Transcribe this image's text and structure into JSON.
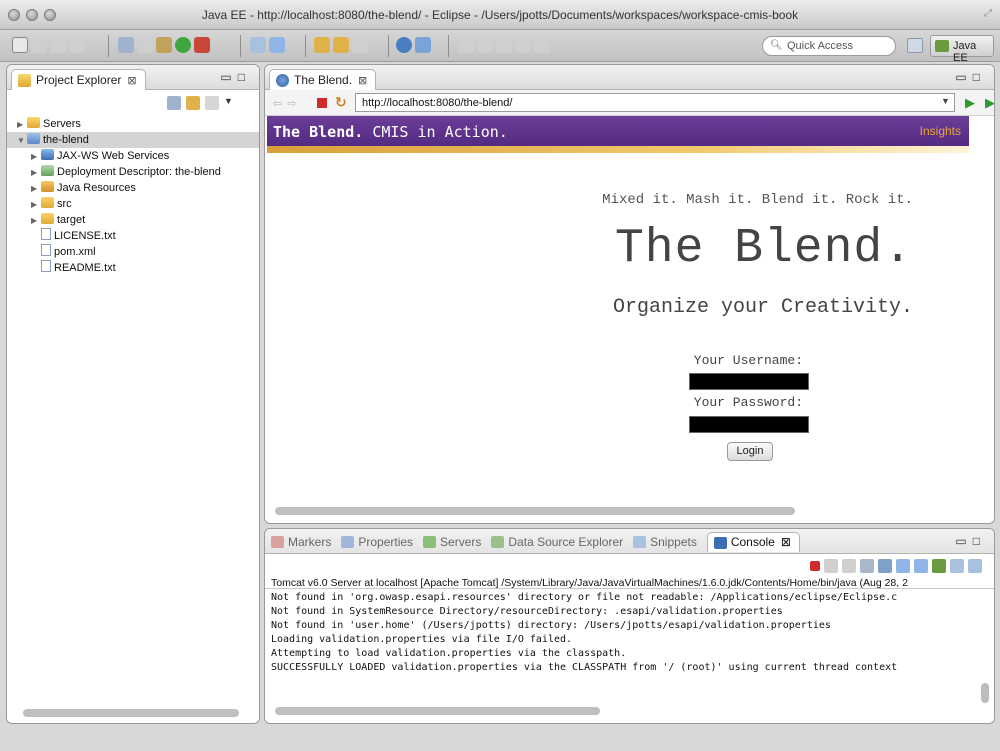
{
  "window": {
    "title": "Java EE - http://localhost:8080/the-blend/ - Eclipse - /Users/jpotts/Documents/workspaces/workspace-cmis-book"
  },
  "toolbar": {
    "quick_access_placeholder": "Quick Access",
    "perspective_label": "Java EE"
  },
  "project_explorer": {
    "tab_label": "Project Explorer",
    "close_glyph": "⊠",
    "tree": [
      {
        "label": "Servers",
        "icon": "folder-icon",
        "twisty": "▶",
        "indent": 0
      },
      {
        "label": "the-blend",
        "icon": "project-icon",
        "twisty": "▼",
        "indent": 0,
        "selected": true
      },
      {
        "label": "JAX-WS Web Services",
        "icon": "web-services-icon",
        "twisty": "▶",
        "indent": 1
      },
      {
        "label": "Deployment Descriptor: the-blend",
        "icon": "deployment-descriptor-icon",
        "twisty": "▶",
        "indent": 1
      },
      {
        "label": "Java Resources",
        "icon": "java-resources-icon",
        "twisty": "▶",
        "indent": 1
      },
      {
        "label": "src",
        "icon": "folder-icon",
        "twisty": "▶",
        "indent": 1
      },
      {
        "label": "target",
        "icon": "folder-icon",
        "twisty": "▶",
        "indent": 1
      },
      {
        "label": "LICENSE.txt",
        "icon": "file-icon",
        "twisty": "",
        "indent": 1
      },
      {
        "label": "pom.xml",
        "icon": "file-icon",
        "twisty": "",
        "indent": 1
      },
      {
        "label": "README.txt",
        "icon": "file-icon",
        "twisty": "",
        "indent": 1
      }
    ]
  },
  "browser": {
    "tab_label": "The Blend.",
    "close_glyph": "⊠",
    "url": "http://localhost:8080/the-blend/",
    "page": {
      "banner_brand": "The Blend.",
      "banner_tagline": "CMIS in Action.",
      "banner_link": "Insights",
      "tagline": "Mixed it. Mash it. Blend it. Rock it.",
      "title": "The Blend.",
      "subtitle": "Organize your Creativity.",
      "username_label": "Your Username:",
      "password_label": "Your Password:",
      "login_button": "Login"
    }
  },
  "console": {
    "tabs": [
      {
        "label": "Markers",
        "icon": "markers-icon",
        "color": "#d9a0a0"
      },
      {
        "label": "Properties",
        "icon": "properties-icon",
        "color": "#a0b7d9"
      },
      {
        "label": "Servers",
        "icon": "servers-icon",
        "color": "#8bbf7a"
      },
      {
        "label": "Data Source Explorer",
        "icon": "data-source-explorer-icon",
        "color": "#9cc08a"
      },
      {
        "label": "Snippets",
        "icon": "snippets-icon",
        "color": "#a7c1de"
      },
      {
        "label": "Console",
        "icon": "console-icon",
        "color": "#3b6db3",
        "active": true
      }
    ],
    "close_glyph": "⊠",
    "description": "Tomcat v6.0 Server at localhost [Apache Tomcat] /System/Library/Java/JavaVirtualMachines/1.6.0.jdk/Contents/Home/bin/java (Aug 28, 2",
    "lines": [
      "Not found in 'org.owasp.esapi.resources' directory or file not readable: /Applications/eclipse/Eclipse.c",
      "Not found in SystemResource Directory/resourceDirectory: .esapi/validation.properties",
      "Not found in 'user.home' (/Users/jpotts) directory: /Users/jpotts/esapi/validation.properties",
      "Loading validation.properties via file I/O failed.",
      "Attempting to load validation.properties via the classpath.",
      "SUCCESSFULLY LOADED validation.properties via the CLASSPATH from '/ (root)' using current thread context"
    ]
  },
  "colors": {
    "banner_purple": "#5e3290",
    "banner_link": "#e8a33a",
    "stop_red": "#d12a2a",
    "run_green": "#2e9a2e"
  }
}
